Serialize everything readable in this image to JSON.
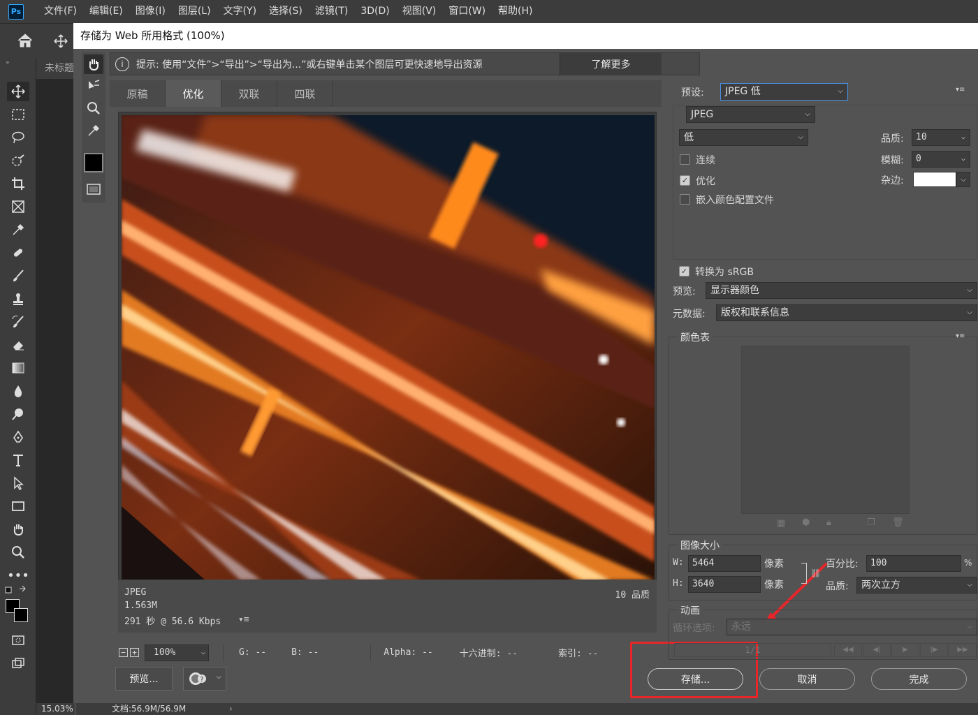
{
  "menu": {
    "logo": "Ps",
    "items": [
      "文件(F)",
      "编辑(E)",
      "图像(I)",
      "图层(L)",
      "文字(Y)",
      "选择(S)",
      "滤镜(T)",
      "3D(D)",
      "视图(V)",
      "窗口(W)",
      "帮助(H)"
    ]
  },
  "document": {
    "tab_title": "未标题",
    "zoom": "15.03%",
    "doc_size": "文档:56.9M/56.9M"
  },
  "dialog": {
    "title": "存储为 Web 所用格式 (100%)",
    "hint": "提示: 使用“文件”>“导出”>“导出为...”或右键单击某个图层可更快速地导出资源",
    "learn_more": "了解更多",
    "tabs": [
      "原稿",
      "优化",
      "双联",
      "四联"
    ],
    "active_tab": "优化",
    "preview_info": {
      "format": "JPEG",
      "size": "1.563M",
      "time": "291 秒 @ 56.6 Kbps",
      "quality": "10 品质"
    },
    "bottom": {
      "zoom": "100%",
      "g": "G: --",
      "b": "B: --",
      "alpha": "Alpha: --",
      "hex": "十六进制: --",
      "index": "索引: --",
      "preview_btn": "预览..."
    },
    "settings": {
      "preset_label": "预设:",
      "preset_value": "JPEG 低",
      "format": "JPEG",
      "quality_preset": "低",
      "quality_label": "品质:",
      "quality_value": "10",
      "blur_label": "模糊:",
      "blur_value": "0",
      "matte_label": "杂边:",
      "progressive_label": "连续",
      "optimized_label": "优化",
      "embed_label": "嵌入颜色配置文件",
      "convert_label": "转换为 sRGB",
      "preview_label": "预览:",
      "preview_value": "显示器颜色",
      "metadata_label": "元数据:",
      "metadata_value": "版权和联系信息",
      "checks": {
        "progressive": false,
        "optimized": true,
        "embed": false,
        "convert": true
      }
    },
    "color_table": {
      "title": "颜色表"
    },
    "image_size": {
      "title": "图像大小",
      "w_label": "W:",
      "w_value": "5464",
      "h_label": "H:",
      "h_value": "3640",
      "unit": "像素",
      "percent_label": "百分比:",
      "percent_value": "100",
      "percent_unit": "%",
      "quality_label": "品质:",
      "quality_value": "两次立方"
    },
    "animation": {
      "title": "动画",
      "loop_label": "循环选项:",
      "loop_value": "永远",
      "frame": "1/1"
    },
    "buttons": {
      "save": "存储...",
      "cancel": "取消",
      "done": "完成"
    }
  },
  "colors": {
    "highlight_box": "#e8262a",
    "accent_select": "#4a90e2"
  }
}
